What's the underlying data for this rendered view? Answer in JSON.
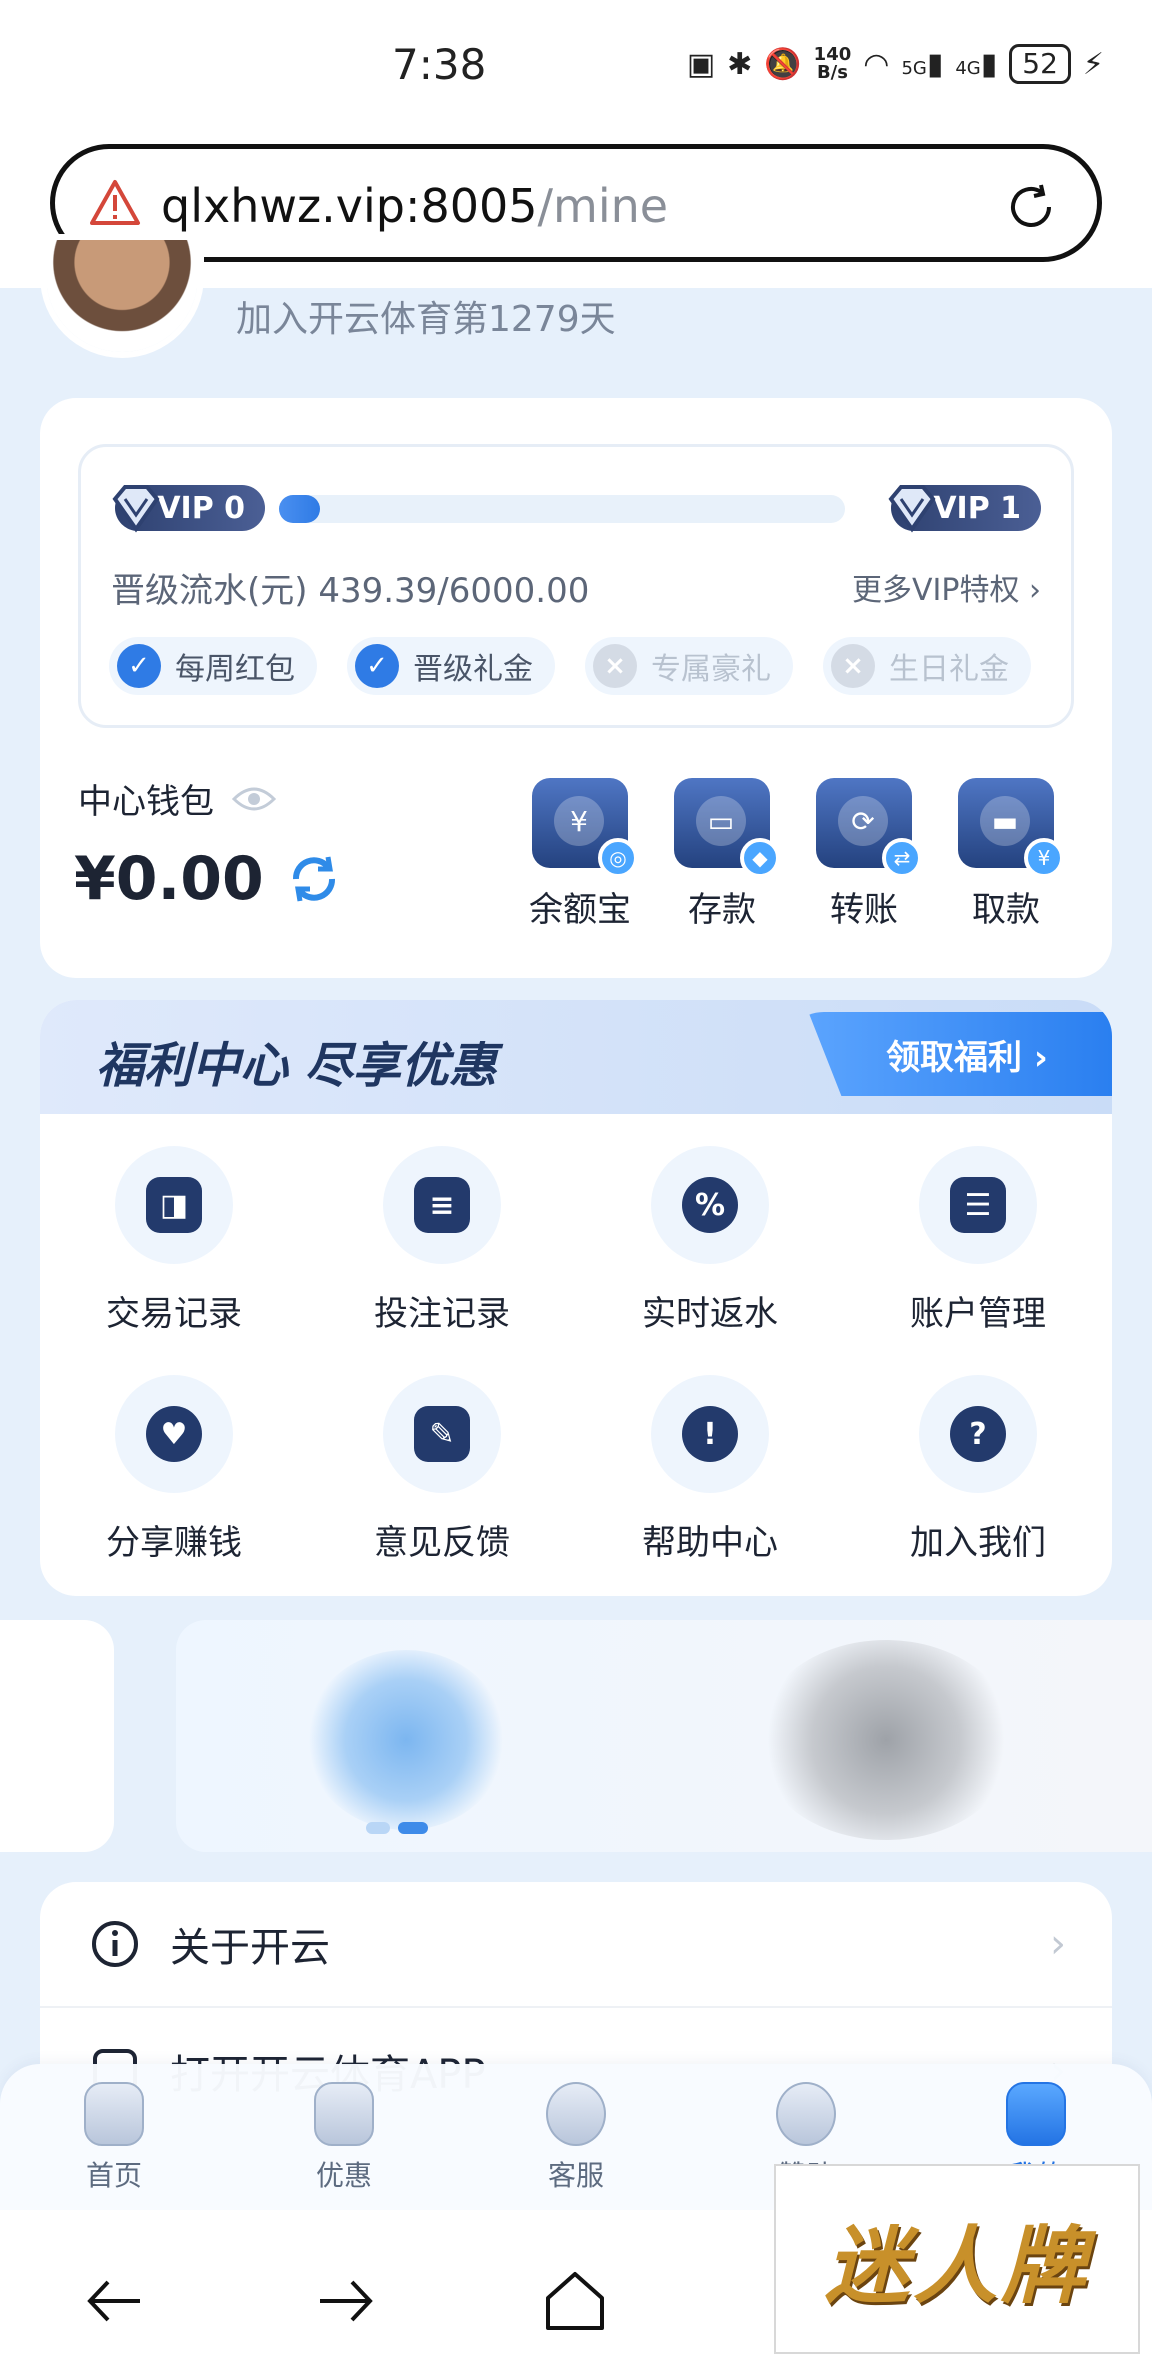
{
  "status_bar": {
    "time": "7:38",
    "net_speed_value": "140",
    "net_speed_unit": "B/s",
    "signal_1": "5G",
    "signal_2": "4G",
    "battery": "52"
  },
  "browser": {
    "url_host": "qlxhwz.vip:8005",
    "url_path": "/mine"
  },
  "profile": {
    "join_text": "加入开云体育第1279天"
  },
  "vip": {
    "current_level": "VIP 0",
    "next_level": "VIP 1",
    "progress_text": "晋级流水(元) 439.39/6000.00",
    "progress_fraction": 0.073,
    "more_link": "更多VIP特权 ›",
    "perks": [
      {
        "label": "每周红包",
        "active": true
      },
      {
        "label": "晋级礼金",
        "active": true
      },
      {
        "label": "专属豪礼",
        "active": false
      },
      {
        "label": "生日礼金",
        "active": false
      }
    ]
  },
  "wallet": {
    "label": "中心钱包",
    "balance": "¥0.00",
    "actions": [
      {
        "label": "余额宝",
        "icon": "yuan-icon"
      },
      {
        "label": "存款",
        "icon": "wallet-icon"
      },
      {
        "label": "转账",
        "icon": "transfer-icon"
      },
      {
        "label": "取款",
        "icon": "card-icon"
      }
    ]
  },
  "welfare": {
    "title": "福利中心 尽享优惠",
    "button": "领取福利 ›",
    "items": [
      {
        "label": "交易记录",
        "icon": "wallet-icon"
      },
      {
        "label": "投注记录",
        "icon": "calendar-icon"
      },
      {
        "label": "实时返水",
        "icon": "percent-badge-icon"
      },
      {
        "label": "账户管理",
        "icon": "id-card-icon"
      },
      {
        "label": "分享赚钱",
        "icon": "handshake-icon"
      },
      {
        "label": "意见反馈",
        "icon": "edit-note-icon"
      },
      {
        "label": "帮助中心",
        "icon": "exclamation-icon"
      },
      {
        "label": "加入我们",
        "icon": "question-icon"
      }
    ]
  },
  "list": {
    "about": "关于开云",
    "open_app": "打开开云体育APP"
  },
  "tabbar": {
    "tabs": [
      {
        "label": "首页",
        "active": false
      },
      {
        "label": "优惠",
        "active": false
      },
      {
        "label": "客服",
        "active": false
      },
      {
        "label": "赞助",
        "active": false
      },
      {
        "label": "我的",
        "active": true
      }
    ]
  },
  "watermark": {
    "text": "迷人牌"
  },
  "colors": {
    "accent": "#2f7be5",
    "navy": "#233a6c",
    "page_bg": "#e6f0fb"
  }
}
